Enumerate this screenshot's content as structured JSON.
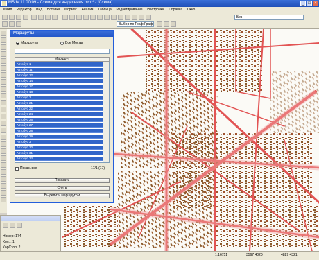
{
  "window": {
    "title": "MSde 11.00.09 - Схема для выделения.mxd* - [Схема]",
    "controls": [
      "_",
      "□",
      "×"
    ]
  },
  "menu": {
    "items": [
      "Файл",
      "Редактор",
      "Вид",
      "Вставка",
      "Формат",
      "Анализ",
      "Таблица",
      "Редактирование",
      "Настройки",
      "Справка",
      "Окно"
    ]
  },
  "toolbar": {
    "layer_combo": "Выбор по Граф Граф...",
    "scale_combo": "Без"
  },
  "routes_panel": {
    "title": "Маршруты",
    "radio_routes": "Маршруты",
    "radio_stops": "Все Мосты",
    "list_header": "Маршрут",
    "routes": [
      "Автобус 1",
      "Автобус 11",
      "Автобус 12",
      "Автобус 14",
      "Автобус 17",
      "Автобус 18",
      "Автобус 2",
      "Автобус 21",
      "Автобус 22",
      "Автобус 24",
      "Автобус 26",
      "Автобус 27",
      "Автобус 28",
      "Автобус 29",
      "Автобус 3",
      "Автобус 30",
      "Автобус 31",
      "Автобус 33"
    ],
    "show_all_label": "Показ. все",
    "count_label": "17/1 (17)",
    "buttons": [
      "Показать",
      "Снять",
      "Выделить маршрутом"
    ]
  },
  "properties_panel": {
    "rows": [
      "Номер: 174",
      "Кол. : 1",
      "КорСтоп: 2"
    ]
  },
  "statusbar": {
    "coord1": "1:16751",
    "coord2": "3567 4020",
    "coord3": "4829 4321"
  }
}
